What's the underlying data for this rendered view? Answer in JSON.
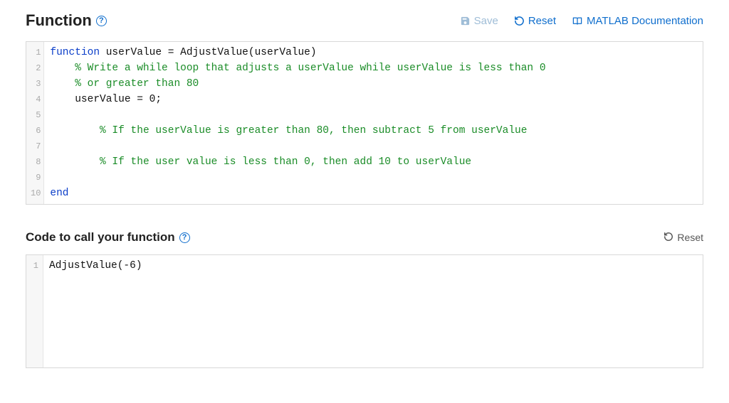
{
  "header": {
    "title": "Function",
    "save_label": "Save",
    "reset_label": "Reset",
    "docs_label": "MATLAB Documentation"
  },
  "editor": {
    "lines": [
      {
        "n": 1,
        "segments": [
          {
            "cls": "tok-kw",
            "t": "function"
          },
          {
            "cls": "tok-txt",
            "t": " userValue = AdjustValue(userValue)"
          }
        ]
      },
      {
        "n": 2,
        "segments": [
          {
            "cls": "tok-txt",
            "t": "    "
          },
          {
            "cls": "tok-cm",
            "t": "% Write a while loop that adjusts a userValue while userValue is less than 0"
          }
        ]
      },
      {
        "n": 3,
        "segments": [
          {
            "cls": "tok-txt",
            "t": "    "
          },
          {
            "cls": "tok-cm",
            "t": "% or greater than 80"
          }
        ]
      },
      {
        "n": 4,
        "segments": [
          {
            "cls": "tok-txt",
            "t": "    userValue = 0;"
          }
        ]
      },
      {
        "n": 5,
        "segments": [
          {
            "cls": "tok-txt",
            "t": ""
          }
        ]
      },
      {
        "n": 6,
        "segments": [
          {
            "cls": "tok-txt",
            "t": "        "
          },
          {
            "cls": "tok-cm",
            "t": "% If the userValue is greater than 80, then subtract 5 from userValue"
          }
        ]
      },
      {
        "n": 7,
        "segments": [
          {
            "cls": "tok-txt",
            "t": ""
          }
        ]
      },
      {
        "n": 8,
        "segments": [
          {
            "cls": "tok-txt",
            "t": "        "
          },
          {
            "cls": "tok-cm",
            "t": "% If the user value is less than 0, then add 10 to userValue"
          }
        ]
      },
      {
        "n": 9,
        "segments": [
          {
            "cls": "tok-txt",
            "t": ""
          }
        ]
      },
      {
        "n": 10,
        "segments": [
          {
            "cls": "tok-kw",
            "t": "end"
          }
        ]
      }
    ]
  },
  "caller": {
    "title": "Code to call your function",
    "reset_label": "Reset",
    "lines": [
      {
        "n": 1,
        "t": "AdjustValue(-6)"
      }
    ]
  }
}
